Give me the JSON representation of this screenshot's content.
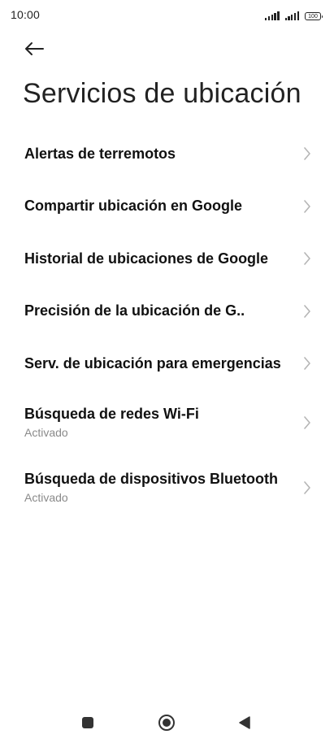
{
  "status_bar": {
    "time": "10:00",
    "battery": "100"
  },
  "header": {
    "back_icon": "arrow-left-icon",
    "title": "Servicios de ubicación"
  },
  "items": [
    {
      "label": "Alertas de terremotos",
      "sub": ""
    },
    {
      "label": "Compartir ubicación en Google",
      "sub": ""
    },
    {
      "label": "Historial de ubicaciones de Google",
      "sub": ""
    },
    {
      "label": "Precisión de la ubicación de G..",
      "sub": ""
    },
    {
      "label": "Serv. de ubicación para emergencias",
      "sub": ""
    },
    {
      "label": "Búsqueda de redes Wi-Fi",
      "sub": "Activado"
    },
    {
      "label": "Búsqueda de dispositivos Bluetooth",
      "sub": "Activado"
    }
  ],
  "nav": {
    "recents_icon": "square-icon",
    "home_icon": "circle-icon",
    "back_icon": "triangle-back-icon"
  },
  "colors": {
    "text": "#111111",
    "secondary": "#8a8a8a",
    "chevron": "#b5b5b5",
    "nav": "#333333"
  }
}
